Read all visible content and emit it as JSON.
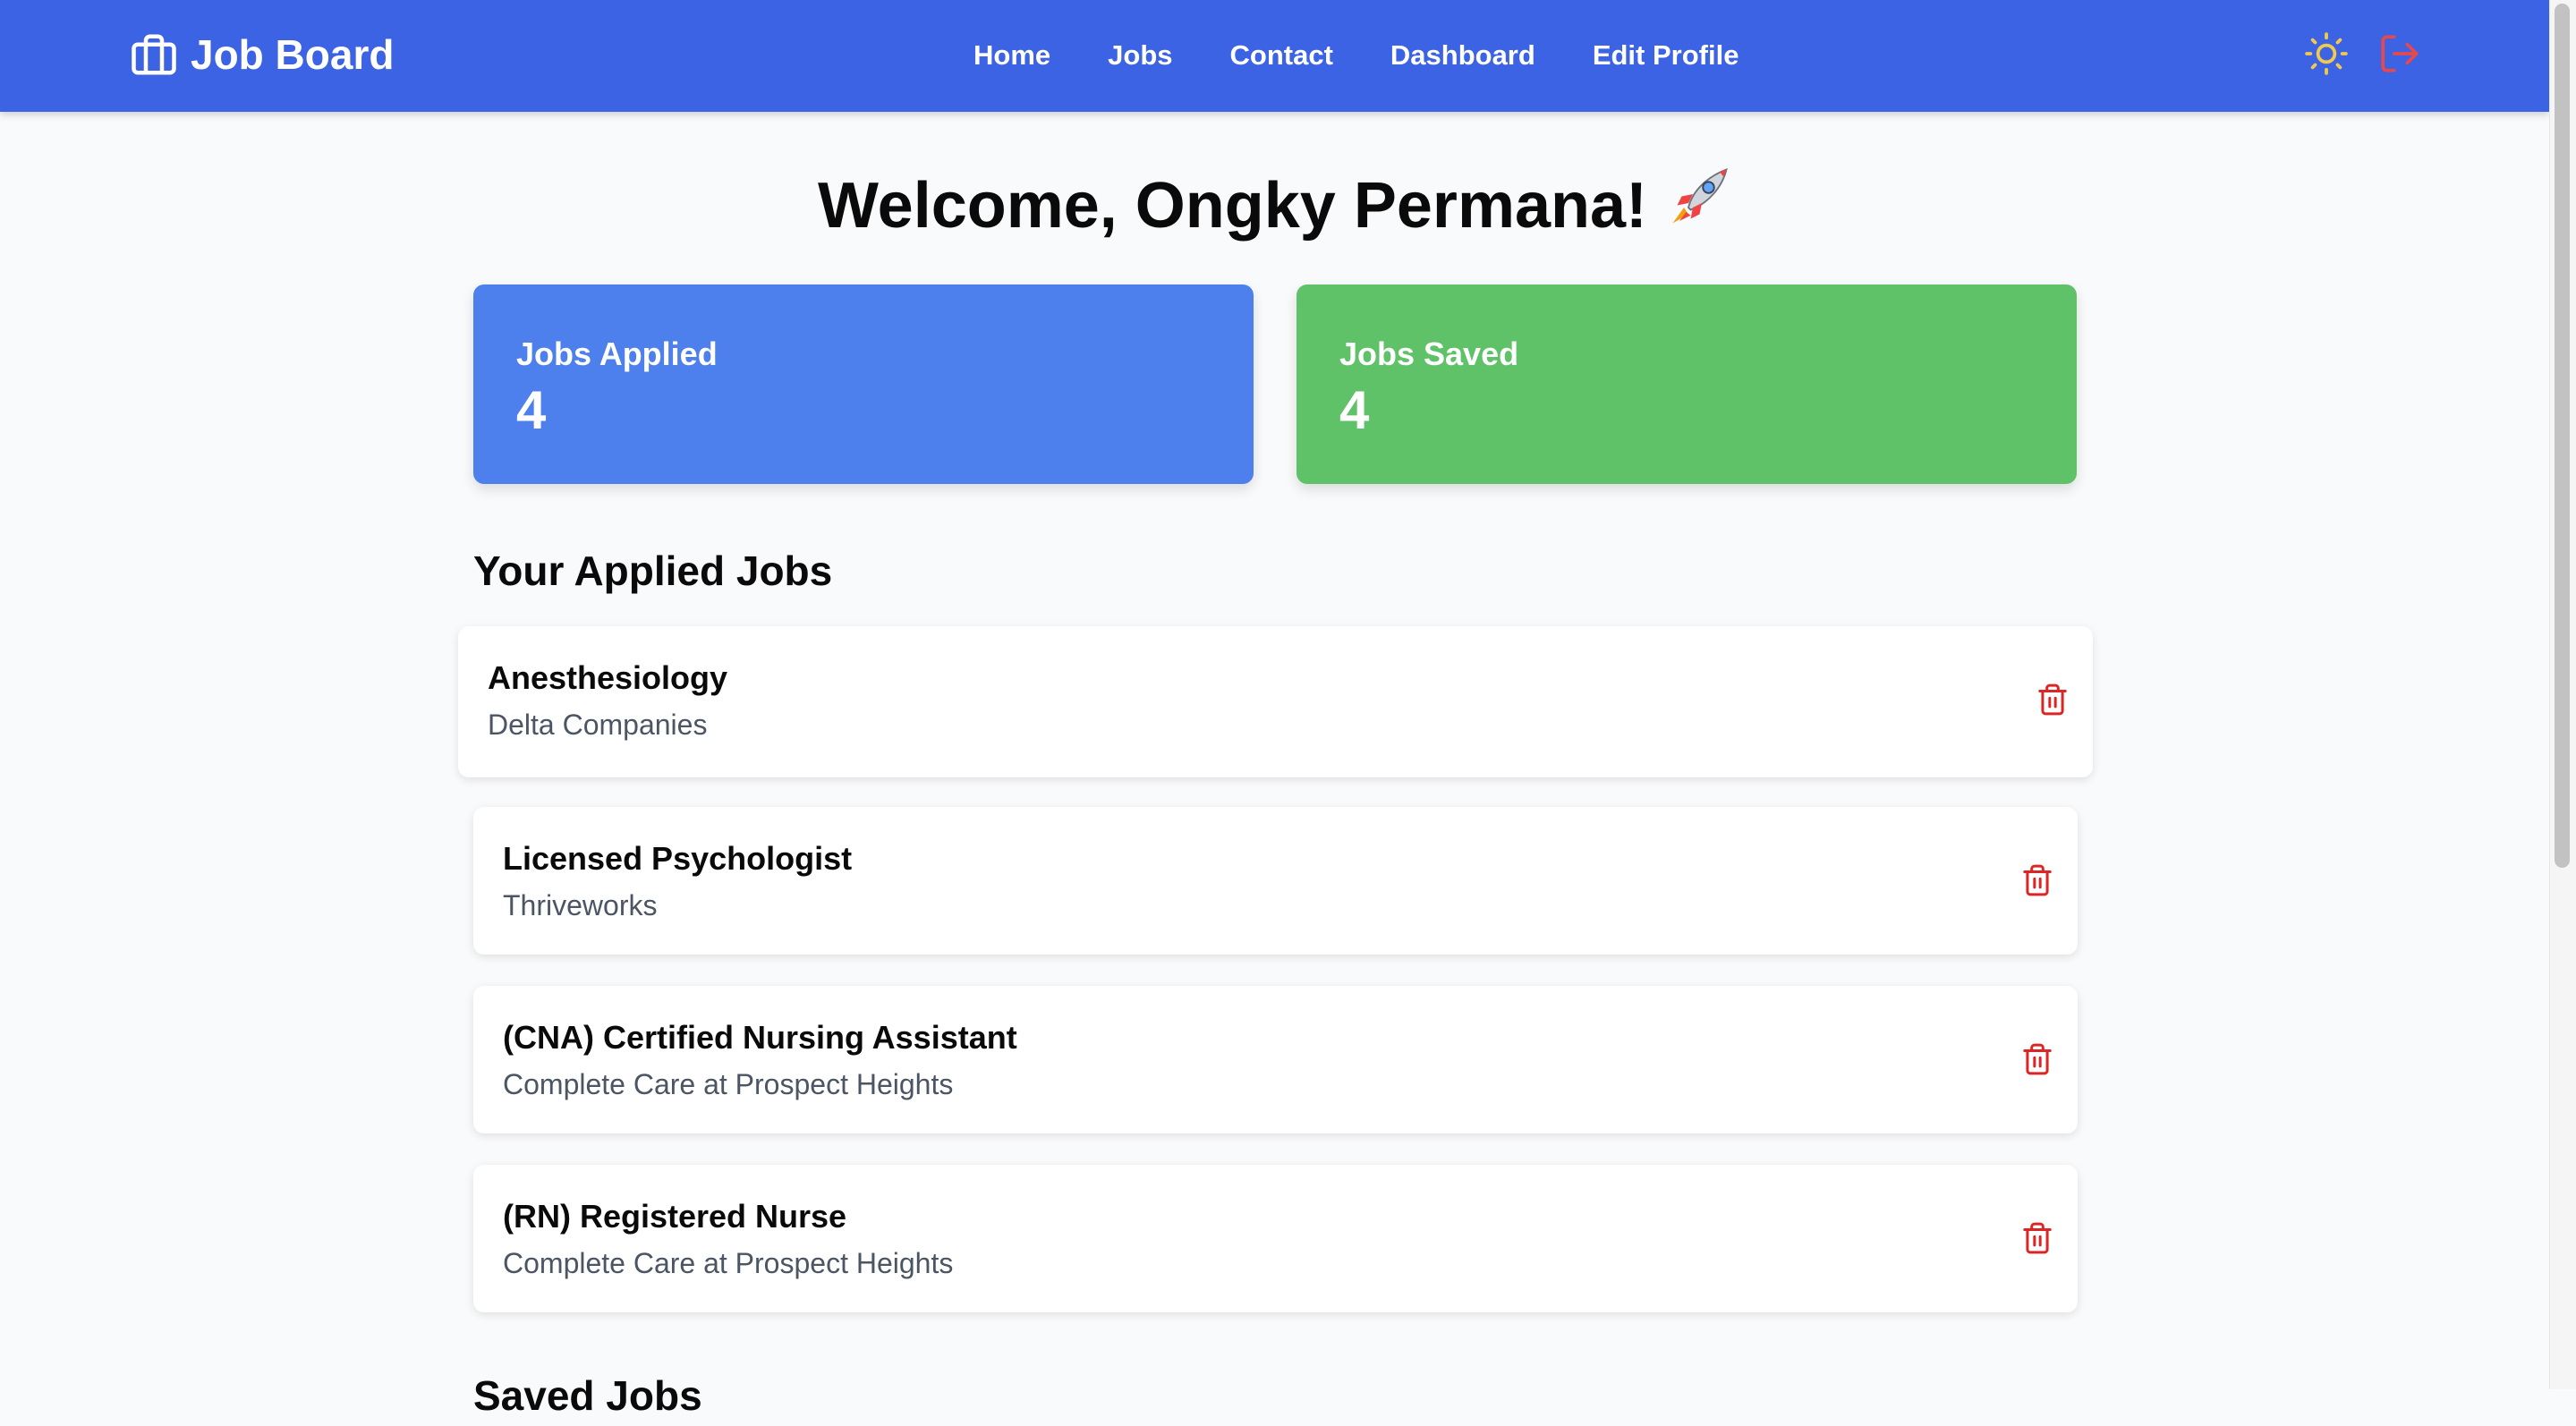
{
  "navbar": {
    "brand": "Job Board",
    "links": [
      {
        "label": "Home"
      },
      {
        "label": "Jobs"
      },
      {
        "label": "Contact"
      },
      {
        "label": "Dashboard"
      },
      {
        "label": "Edit Profile"
      }
    ],
    "icons": {
      "brand": "briefcase-icon",
      "theme_toggle": "sun-icon",
      "logout": "logout-icon"
    },
    "colors": {
      "background": "#3b63e3",
      "sun": "#f2c94c",
      "logout": "#e5484d"
    }
  },
  "welcome": {
    "text": "Welcome, Ongky Permana!",
    "emoji": "rocket-icon"
  },
  "stats": [
    {
      "label": "Jobs Applied",
      "value": "4",
      "color": "#4d80ec"
    },
    {
      "label": "Jobs Saved",
      "value": "4",
      "color": "#5fc269"
    }
  ],
  "applied_section": {
    "title": "Your Applied Jobs",
    "jobs": [
      {
        "title": "Anesthesiology",
        "company": "Delta Companies"
      },
      {
        "title": "Licensed Psychologist",
        "company": "Thriveworks"
      },
      {
        "title": "(CNA) Certified Nursing Assistant",
        "company": "Complete Care at Prospect Heights"
      },
      {
        "title": "(RN) Registered Nurse",
        "company": "Complete Care at Prospect Heights"
      }
    ],
    "delete_icon": "trash-icon",
    "delete_color": "#dc2626"
  },
  "saved_section": {
    "title": "Saved Jobs"
  }
}
